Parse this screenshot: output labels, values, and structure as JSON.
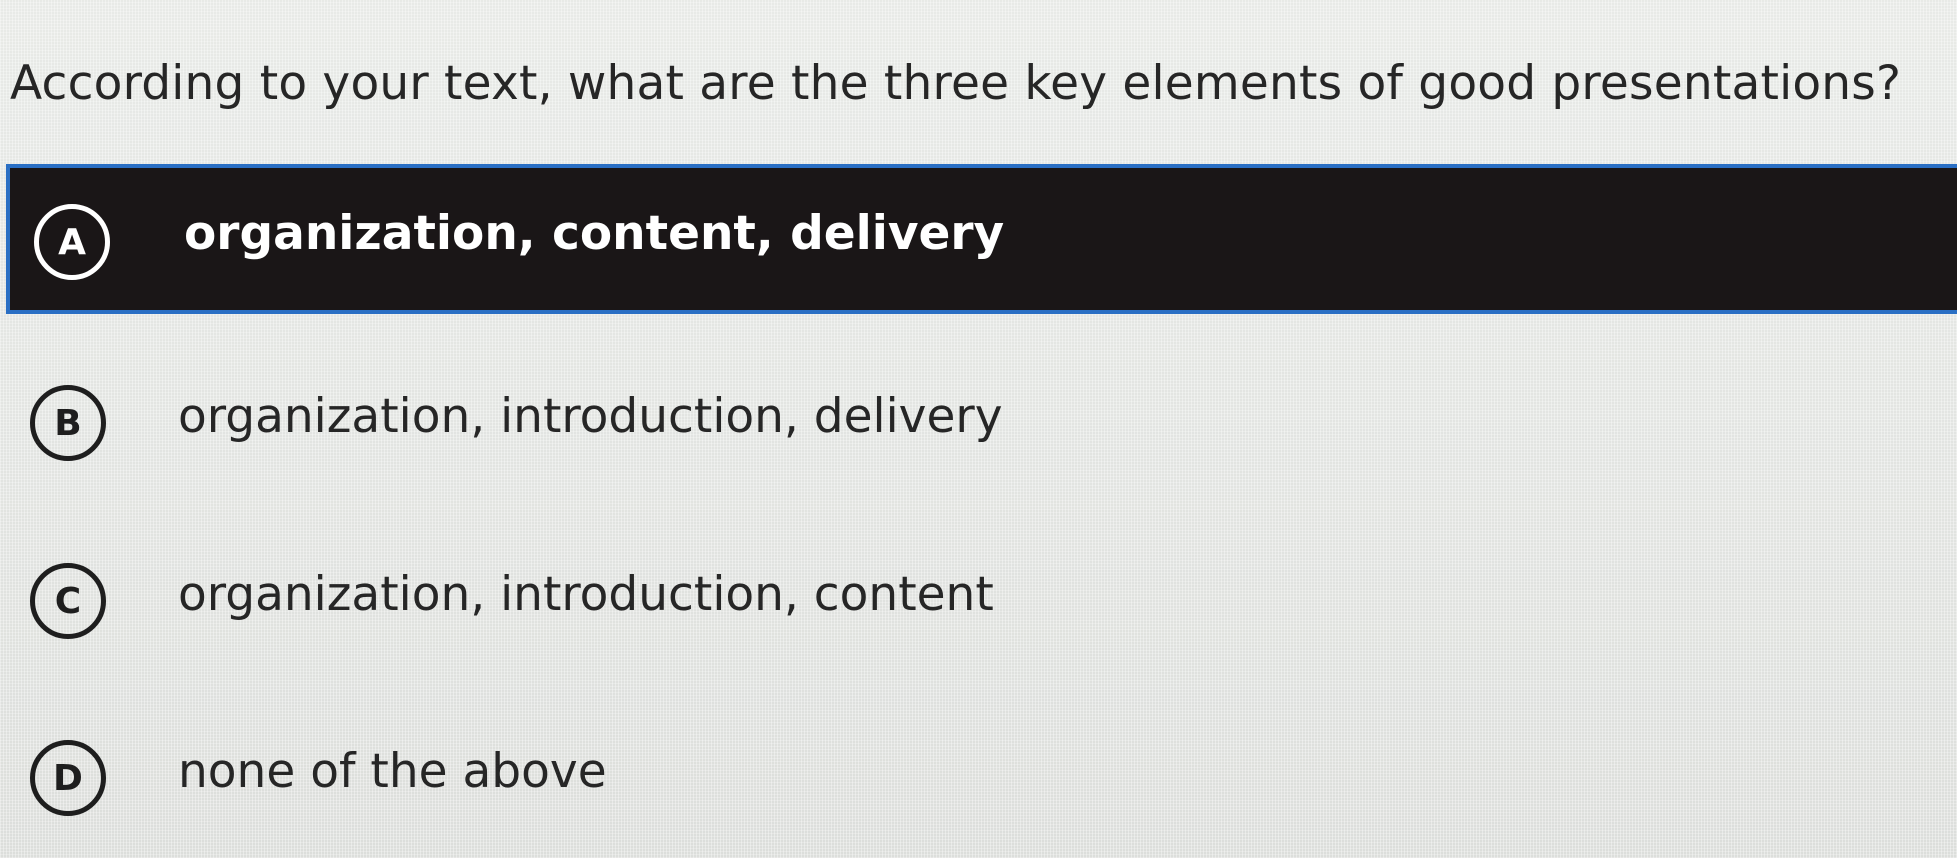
{
  "question": {
    "text": "According to your text, what are the three key elements of good presentations?"
  },
  "options": [
    {
      "letter": "A",
      "text": "organization, content, delivery",
      "selected": true
    },
    {
      "letter": "B",
      "text": "organization, introduction, delivery",
      "selected": false
    },
    {
      "letter": "C",
      "text": "organization, introduction, content",
      "selected": false
    },
    {
      "letter": "D",
      "text": "none of the above",
      "selected": false
    }
  ],
  "colors": {
    "selected_background": "#1a1617",
    "selected_border": "#2a6fc4",
    "page_background": "#e4e6e3",
    "text": "#262626"
  }
}
